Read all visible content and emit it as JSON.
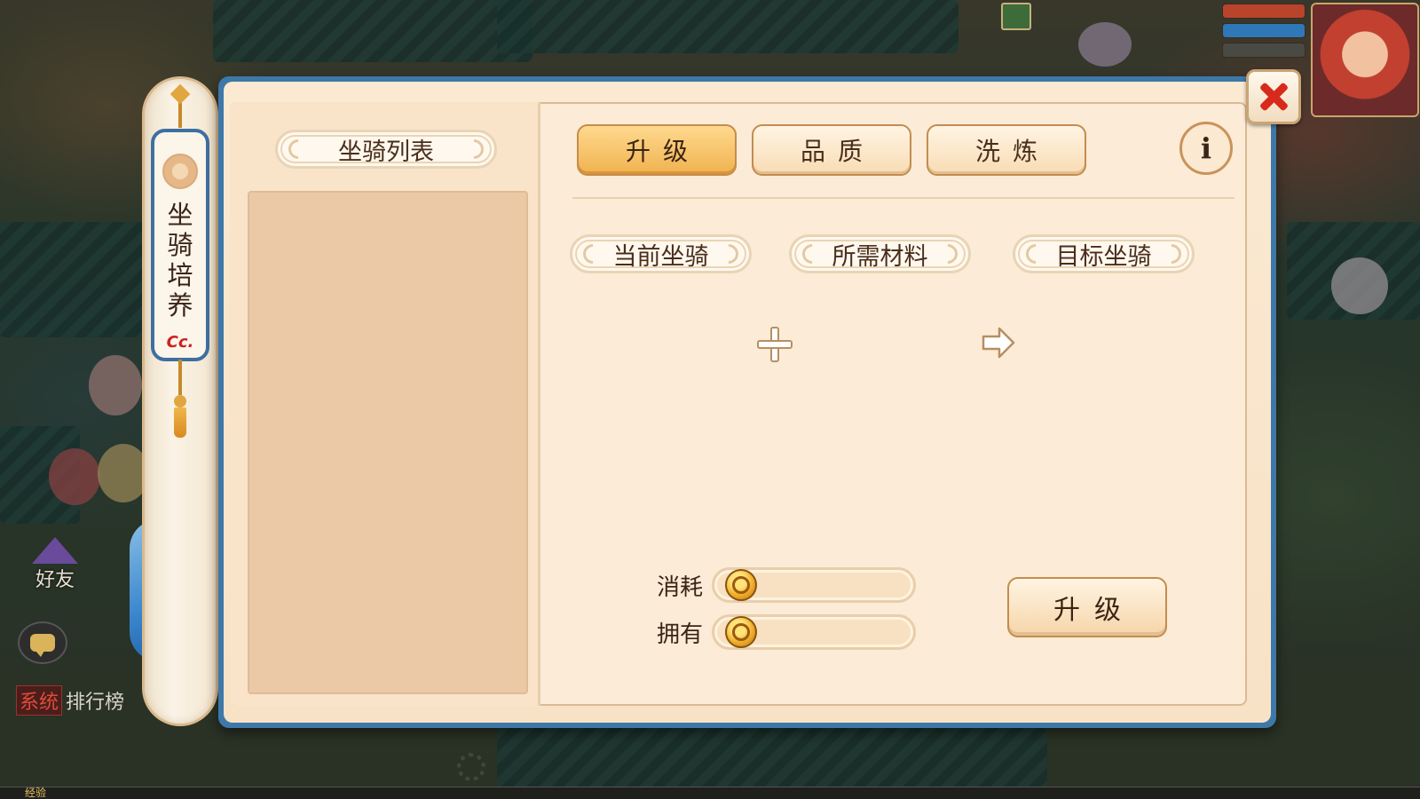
{
  "window": {
    "title": "坐骑培养",
    "close_icon": "close-icon",
    "info_icon": "info-icon"
  },
  "mount_list": {
    "header": "坐骑列表"
  },
  "tabs": [
    {
      "label": "升级",
      "active": true
    },
    {
      "label": "品质",
      "active": false
    },
    {
      "label": "洗炼",
      "active": false
    }
  ],
  "sections": {
    "current_mount": "当前坐骑",
    "required_materials": "所需材料",
    "target_mount": "目标坐骑"
  },
  "cost": {
    "consume_label": "消耗",
    "consume_value": "",
    "own_label": "拥有",
    "own_value": "",
    "currency_icon": "gold-coin-icon"
  },
  "actions": {
    "upgrade_label": "升级"
  },
  "hud": {
    "friends_label": "好友",
    "chat_system_tag": "系统",
    "chat_message": "排行榜",
    "exp_label": "经验",
    "logo_text": "Cc."
  },
  "colors": {
    "active_tab": "#f0b24f",
    "panel_border": "#3e78a8",
    "close_red": "#d72a1c"
  }
}
